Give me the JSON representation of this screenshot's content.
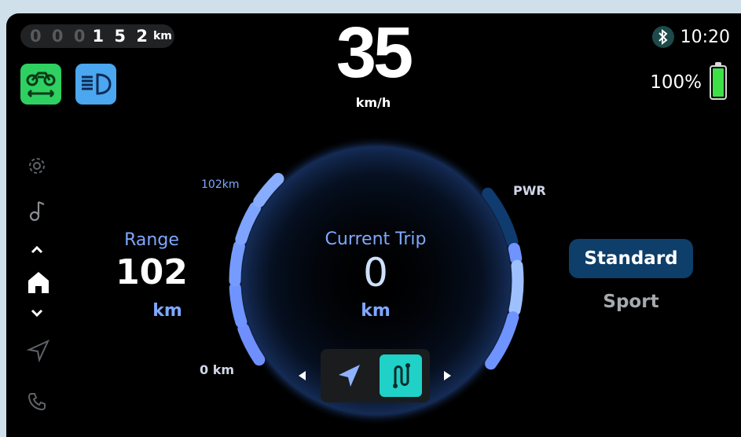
{
  "odometer": {
    "leading_digits": "0 0 0",
    "digits": "1 5 2",
    "unit": "km"
  },
  "speed": {
    "value": "35",
    "unit": "km/h"
  },
  "status": {
    "time": "10:20",
    "battery_percent": "100%",
    "battery_level": 1.0,
    "bluetooth_icon": "bluetooth-icon"
  },
  "indicators": [
    {
      "name": "motorcycle-stand-icon",
      "color": "#2ed061"
    },
    {
      "name": "headlight-icon",
      "color": "#4aa7f0"
    }
  ],
  "sidebar": {
    "icons": [
      "settings-icon",
      "music-icon",
      "chevron-up-icon",
      "home-icon",
      "chevron-down-icon",
      "navigation-icon",
      "phone-icon"
    ],
    "active": "home-icon"
  },
  "range": {
    "label": "Range",
    "value": "102",
    "unit": "km",
    "max_label": "102km",
    "min_label": "0 km"
  },
  "trip": {
    "label": "Current Trip",
    "value": "0",
    "unit": "km"
  },
  "power": {
    "label": "PWR"
  },
  "modes": {
    "standard": "Standard",
    "sport": "Sport",
    "selected": "Standard"
  },
  "bottom_nav": {
    "items": [
      "navigation-arrow-icon",
      "route-icon"
    ],
    "active": "route-icon"
  },
  "colors": {
    "accent_blue": "#7fa8ff",
    "mode_selected_bg": "#0e3e6a",
    "route_active": "#1fd1c6",
    "battery_green": "#3ee047"
  }
}
